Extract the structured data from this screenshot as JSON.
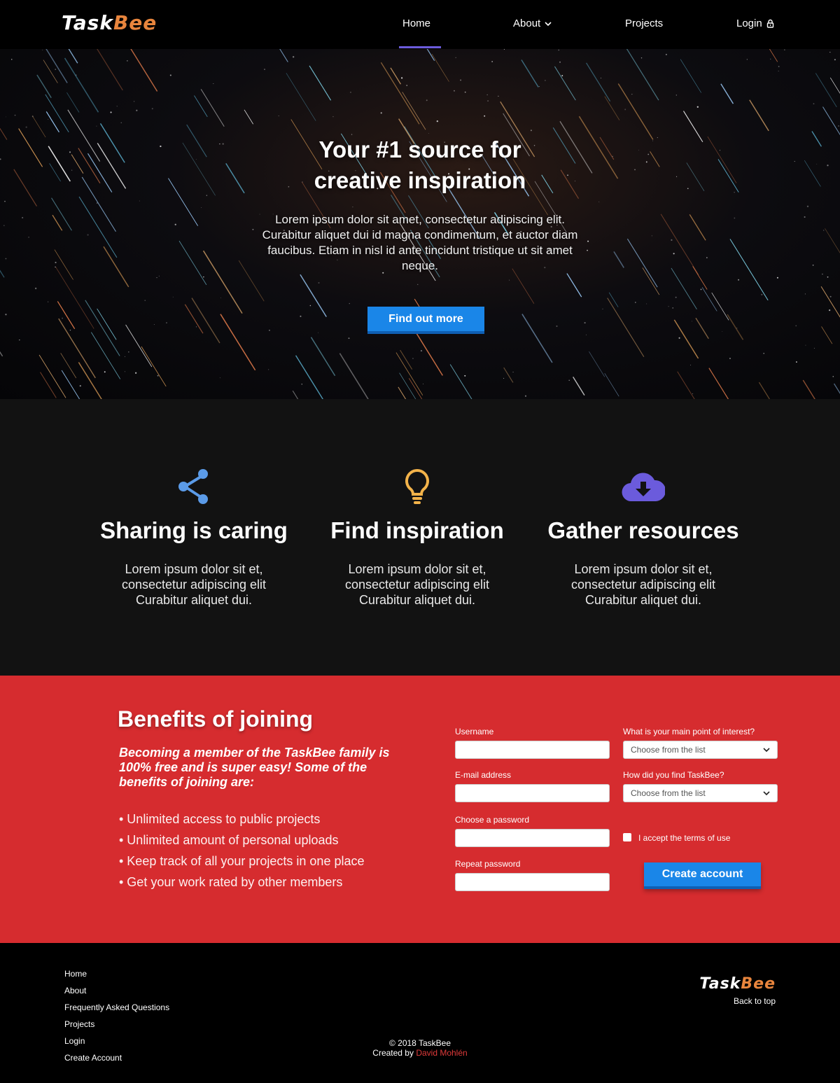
{
  "brand": {
    "part1": "Task",
    "part2": "Bee"
  },
  "nav": {
    "home": "Home",
    "about": "About",
    "projects": "Projects",
    "login": "Login"
  },
  "hero": {
    "title_line1": "Your #1 source for",
    "title_line2": "creative inspiration",
    "text": "Lorem ipsum dolor sit amet, consectetur adipiscing elit. Curabitur aliquet dui id magna condimentum, et auctor diam faucibus. Etiam in nisl id ante tincidunt tristique ut sit amet neque.",
    "button": "Find out more"
  },
  "features": [
    {
      "icon": "share-icon",
      "title": "Sharing is caring",
      "text": "Lorem ipsum dolor sit et, consectetur adipiscing elit Curabitur aliquet dui."
    },
    {
      "icon": "lightbulb-icon",
      "title": "Find inspiration",
      "text": "Lorem ipsum dolor sit et, consectetur adipiscing elit Curabitur aliquet dui."
    },
    {
      "icon": "cloud-download-icon",
      "title": "Gather resources",
      "text": "Lorem ipsum dolor sit et, consectetur adipiscing elit Curabitur aliquet dui."
    }
  ],
  "benefits": {
    "title": "Benefits of joining",
    "intro": "Becoming a member of the TaskBee family is 100% free and is super easy! Some of the benefits of joining are:",
    "items": [
      "• Unlimited access to public projects",
      "• Unlimited amount of personal uploads",
      "• Keep track of all your projects in one place",
      "• Get your work rated by other members"
    ]
  },
  "form": {
    "username_label": "Username",
    "email_label": "E-mail address",
    "password_label": "Choose a password",
    "repeat_label": "Repeat password",
    "interest_label": "What is your main point of interest?",
    "interest_value": "Choose from the list",
    "source_label": "How did you find TaskBee?",
    "source_value": "Choose from the list",
    "terms_label": "I accept the terms of use",
    "submit": "Create account"
  },
  "footer": {
    "links": [
      "Home",
      "About",
      "Frequently Asked Questions",
      "Projects",
      "Login",
      "Create Account"
    ],
    "back_to_top": "Back to top",
    "copyright": "© 2018 TaskBee",
    "created_by": "Created by",
    "author": "David Mohlén"
  },
  "colors": {
    "accent_blue": "#1a86e8",
    "nav_underline": "#6b5bdc",
    "brand_orange": "#e8853d",
    "benefits_red": "#d62c2f",
    "share_icon": "#5b9be8",
    "bulb_icon": "#f3b34a",
    "cloud_icon": "#6b5bdc",
    "author_red": "#e03a3a"
  }
}
